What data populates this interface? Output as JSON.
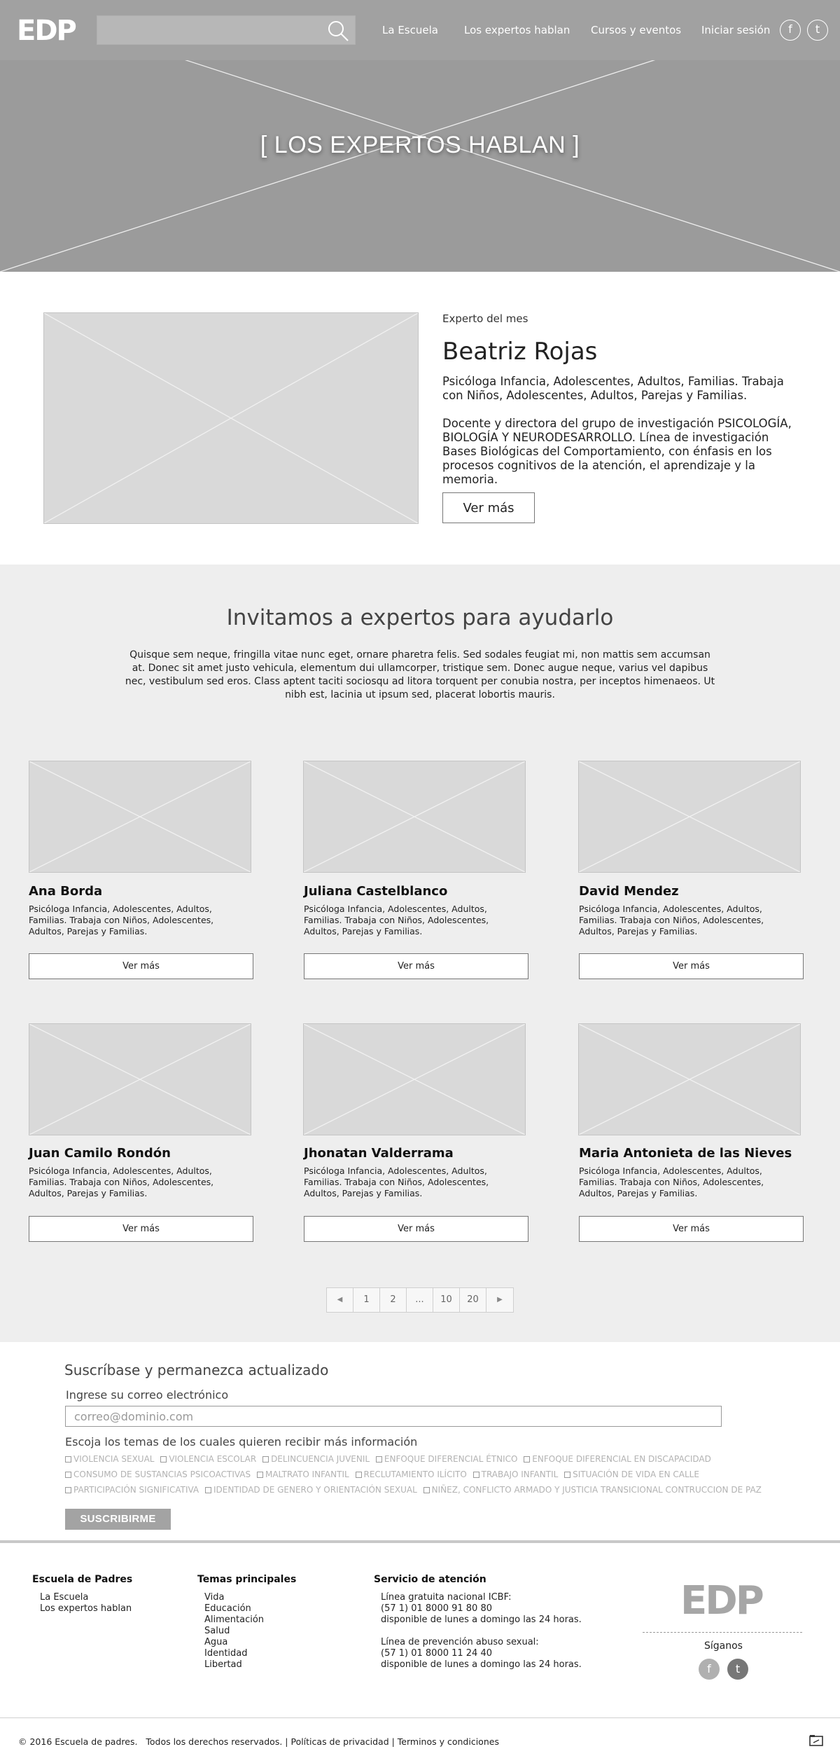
{
  "header": {
    "logo": "EDP",
    "search": {
      "placeholder": "",
      "value": ""
    },
    "nav": [
      "La Escuela",
      "Los expertos hablan",
      "Cursos y eventos",
      "Iniciar sesión"
    ],
    "social": {
      "facebook": "f",
      "twitter": "t"
    },
    "hero_title": "[ LOS EXPERTOS HABLAN ]"
  },
  "featured": {
    "label": "Experto del mes",
    "name": "Beatriz Rojas",
    "description": "Psicóloga Infancia, Adolescentes, Adultos, Familias. Trabaja con Niños, Adolescentes, Adultos, Parejas y Familias.",
    "bio": "Docente y directora del grupo de investigación PSICOLOGÍA, BIOLOGÍA Y NEURODESARROLLO. Línea de investigación Bases Biológicas del Comportamiento, con énfasis en los procesos cognitivos de la atención, el aprendizaje y la memoria.",
    "button": "Ver más"
  },
  "experts_section": {
    "title": "Invitamos a expertos para ayudarlo",
    "intro": "Quisque sem neque, fringilla vitae nunc eget, ornare pharetra felis. Sed sodales feugiat mi, non mattis sem accumsan at. Donec sit amet justo vehicula, elementum dui ullamcorper, tristique sem. Donec augue neque, varius vel dapibus nec, vestibulum sed eros. Class aptent taciti sociosqu ad litora torquent per conubia nostra, per inceptos himenaeos. Ut nibh est, lacinia ut ipsum sed, placerat lobortis mauris.",
    "cards": [
      {
        "name": "Ana Borda",
        "description": "Psicóloga Infancia, Adolescentes, Adultos, Familias. Trabaja con Niños, Adolescentes, Adultos, Parejas y Familias.",
        "button": "Ver más"
      },
      {
        "name": "Juliana Castelblanco",
        "description": "Psicóloga Infancia, Adolescentes, Adultos, Familias. Trabaja con Niños, Adolescentes, Adultos, Parejas y Familias.",
        "button": "Ver más"
      },
      {
        "name": "David Mendez",
        "description": "Psicóloga Infancia, Adolescentes, Adultos, Familias. Trabaja con Niños, Adolescentes, Adultos, Parejas y Familias.",
        "button": "Ver más"
      },
      {
        "name": "Juan Camilo Rondón",
        "description": "Psicóloga Infancia, Adolescentes, Adultos, Familias. Trabaja con Niños, Adolescentes, Adultos, Parejas y Familias.",
        "button": "Ver más"
      },
      {
        "name": "Jhonatan Valderrama",
        "description": "Psicóloga Infancia, Adolescentes, Adultos, Familias. Trabaja con Niños, Adolescentes, Adultos, Parejas y Familias.",
        "button": "Ver más"
      },
      {
        "name": "Maria Antonieta de las Nieves",
        "description": "Psicóloga Infancia, Adolescentes, Adultos, Familias. Trabaja con Niños, Adolescentes, Adultos, Parejas y Familias.",
        "button": "Ver más"
      }
    ],
    "pagination": {
      "prev": "◀",
      "pages": [
        "1",
        "2",
        "...",
        "10",
        "20"
      ],
      "next": "▶"
    }
  },
  "newsletter": {
    "title": "Suscríbase y permanezca actualizado",
    "email_label": "Ingrese su correo electrónico",
    "email_placeholder": "correo@dominio.com",
    "topics_label": "Escoja los temas de los cuales quieren recibir más información",
    "topics": [
      [
        "VIOLENCIA SEXUAL",
        "VIOLENCIA ESCOLAR",
        "DELINCUENCIA JUVENIL",
        "ENFOQUE DIFERENCIAL ÉTNICO",
        "ENFOQUE DIFERENCIAL EN DISCAPACIDAD"
      ],
      [
        "CONSUMO DE SUSTANCIAS PSICOACTIVAS",
        "MALTRATO INFANTIL",
        "RECLUTAMIENTO ILÍCITO",
        "TRABAJO INFANTIL",
        "SITUACIÓN DE VIDA EN CALLE"
      ],
      [
        "PARTICIPACIÓN SIGNIFICATIVA",
        "IDENTIDAD DE GENERO Y ORIENTACIÓN SEXUAL",
        "NIÑEZ, CONFLICTO ARMADO Y JUSTICIA TRANSICIONAL CONTRUCCION DE PAZ"
      ]
    ],
    "button": "SUSCRIBIRME"
  },
  "footer": {
    "col1": {
      "heading": "Escuela de Padres",
      "links": [
        "La Escuela",
        "Los expertos hablan"
      ]
    },
    "col2": {
      "heading": "Temas principales",
      "links": [
        "Vida",
        "Educación",
        "Alimentación",
        "Salud",
        "Agua",
        "Identidad",
        "Libertad"
      ]
    },
    "col3": {
      "heading": "Servicio de atención",
      "lines": [
        "Línea gratuita nacional ICBF:",
        "(57 1) 01 8000 91 80 80",
        "disponible de lunes a domingo las 24 horas.",
        "Línea de prevención abuso sexual:",
        "(57 1) 01 8000 11 24 40",
        "disponible de lunes a domingo las 24 horas."
      ]
    },
    "logo": "EDP",
    "follow": "Síganos",
    "social": {
      "facebook": "f",
      "twitter": "t"
    },
    "copyright": "© 2016 Escuela de padres.   Todos los derechos reservados. | Políticas de privacidad | Terminos y condiciones"
  },
  "colors": {
    "hero_bg": "#9b9b9b",
    "section_bg": "#eeeeee",
    "placeholder": "#d9d9d9",
    "button_gray": "#a3a3a3",
    "facebook_circle": "#b0b0b0",
    "twitter_circle": "#777777"
  }
}
